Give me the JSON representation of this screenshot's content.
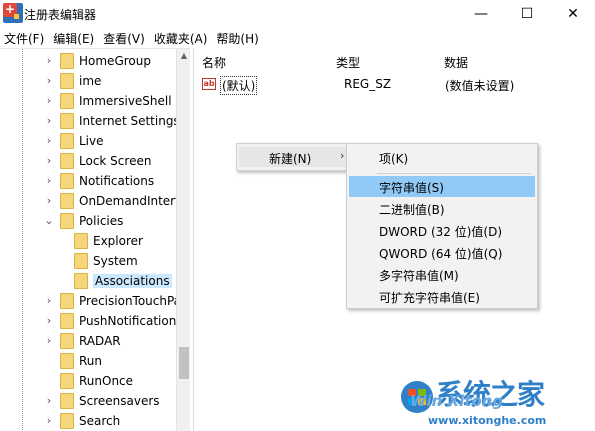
{
  "window": {
    "title": "注册表编辑器",
    "min_glyph": "—",
    "max_glyph": "☐",
    "close_glyph": "✕"
  },
  "menubar": [
    "文件(F)",
    "编辑(E)",
    "查看(V)",
    "收藏夹(A)",
    "帮助(H)"
  ],
  "tree": {
    "items": [
      {
        "label": "HomeGroup",
        "expander": "›",
        "level": 1
      },
      {
        "label": "ime",
        "expander": "›",
        "level": 1
      },
      {
        "label": "ImmersiveShell",
        "expander": "›",
        "level": 1
      },
      {
        "label": "Internet Settings",
        "expander": "›",
        "level": 1
      },
      {
        "label": "Live",
        "expander": "›",
        "level": 1
      },
      {
        "label": "Lock Screen",
        "expander": "›",
        "level": 1
      },
      {
        "label": "Notifications",
        "expander": "›",
        "level": 1
      },
      {
        "label": "OnDemandInterfac",
        "expander": "›",
        "level": 1
      },
      {
        "label": "Policies",
        "expander": "⌄",
        "level": 1
      },
      {
        "label": "Explorer",
        "expander": "",
        "level": 2
      },
      {
        "label": "System",
        "expander": "",
        "level": 2
      },
      {
        "label": "Associations",
        "expander": "",
        "level": 2,
        "selected": true
      },
      {
        "label": "PrecisionTouchPac",
        "expander": "›",
        "level": 1
      },
      {
        "label": "PushNotifications",
        "expander": "›",
        "level": 1
      },
      {
        "label": "RADAR",
        "expander": "›",
        "level": 1
      },
      {
        "label": "Run",
        "expander": "",
        "level": 1
      },
      {
        "label": "RunOnce",
        "expander": "",
        "level": 1
      },
      {
        "label": "Screensavers",
        "expander": "›",
        "level": 1
      },
      {
        "label": "Search",
        "expander": "›",
        "level": 1
      }
    ]
  },
  "values_pane": {
    "headers": {
      "name": "名称",
      "type": "类型",
      "data": "数据"
    },
    "rows": [
      {
        "icon": "ab",
        "name": "(默认)",
        "type": "REG_SZ",
        "data": "(数值未设置)"
      }
    ]
  },
  "context_menu": {
    "new_label": "新建(N)",
    "arrow": "›"
  },
  "submenu": {
    "items": [
      {
        "label": "项(K)"
      },
      {
        "label": "字符串值(S)",
        "highlighted": true
      },
      {
        "label": "二进制值(B)"
      },
      {
        "label": "DWORD (32 位)值(D)"
      },
      {
        "label": "QWORD (64 位)值(Q)"
      },
      {
        "label": "多字符串值(M)"
      },
      {
        "label": "可扩充字符串值(E)"
      }
    ]
  },
  "watermark": {
    "brand": "系统之家",
    "brand_latin": "Win Xitong",
    "url": "www.xitonghe.com"
  },
  "colors": {
    "submenu_highlight": "#91c9f7",
    "folder": "#f5d67a",
    "watermark": "#2f80c8"
  }
}
